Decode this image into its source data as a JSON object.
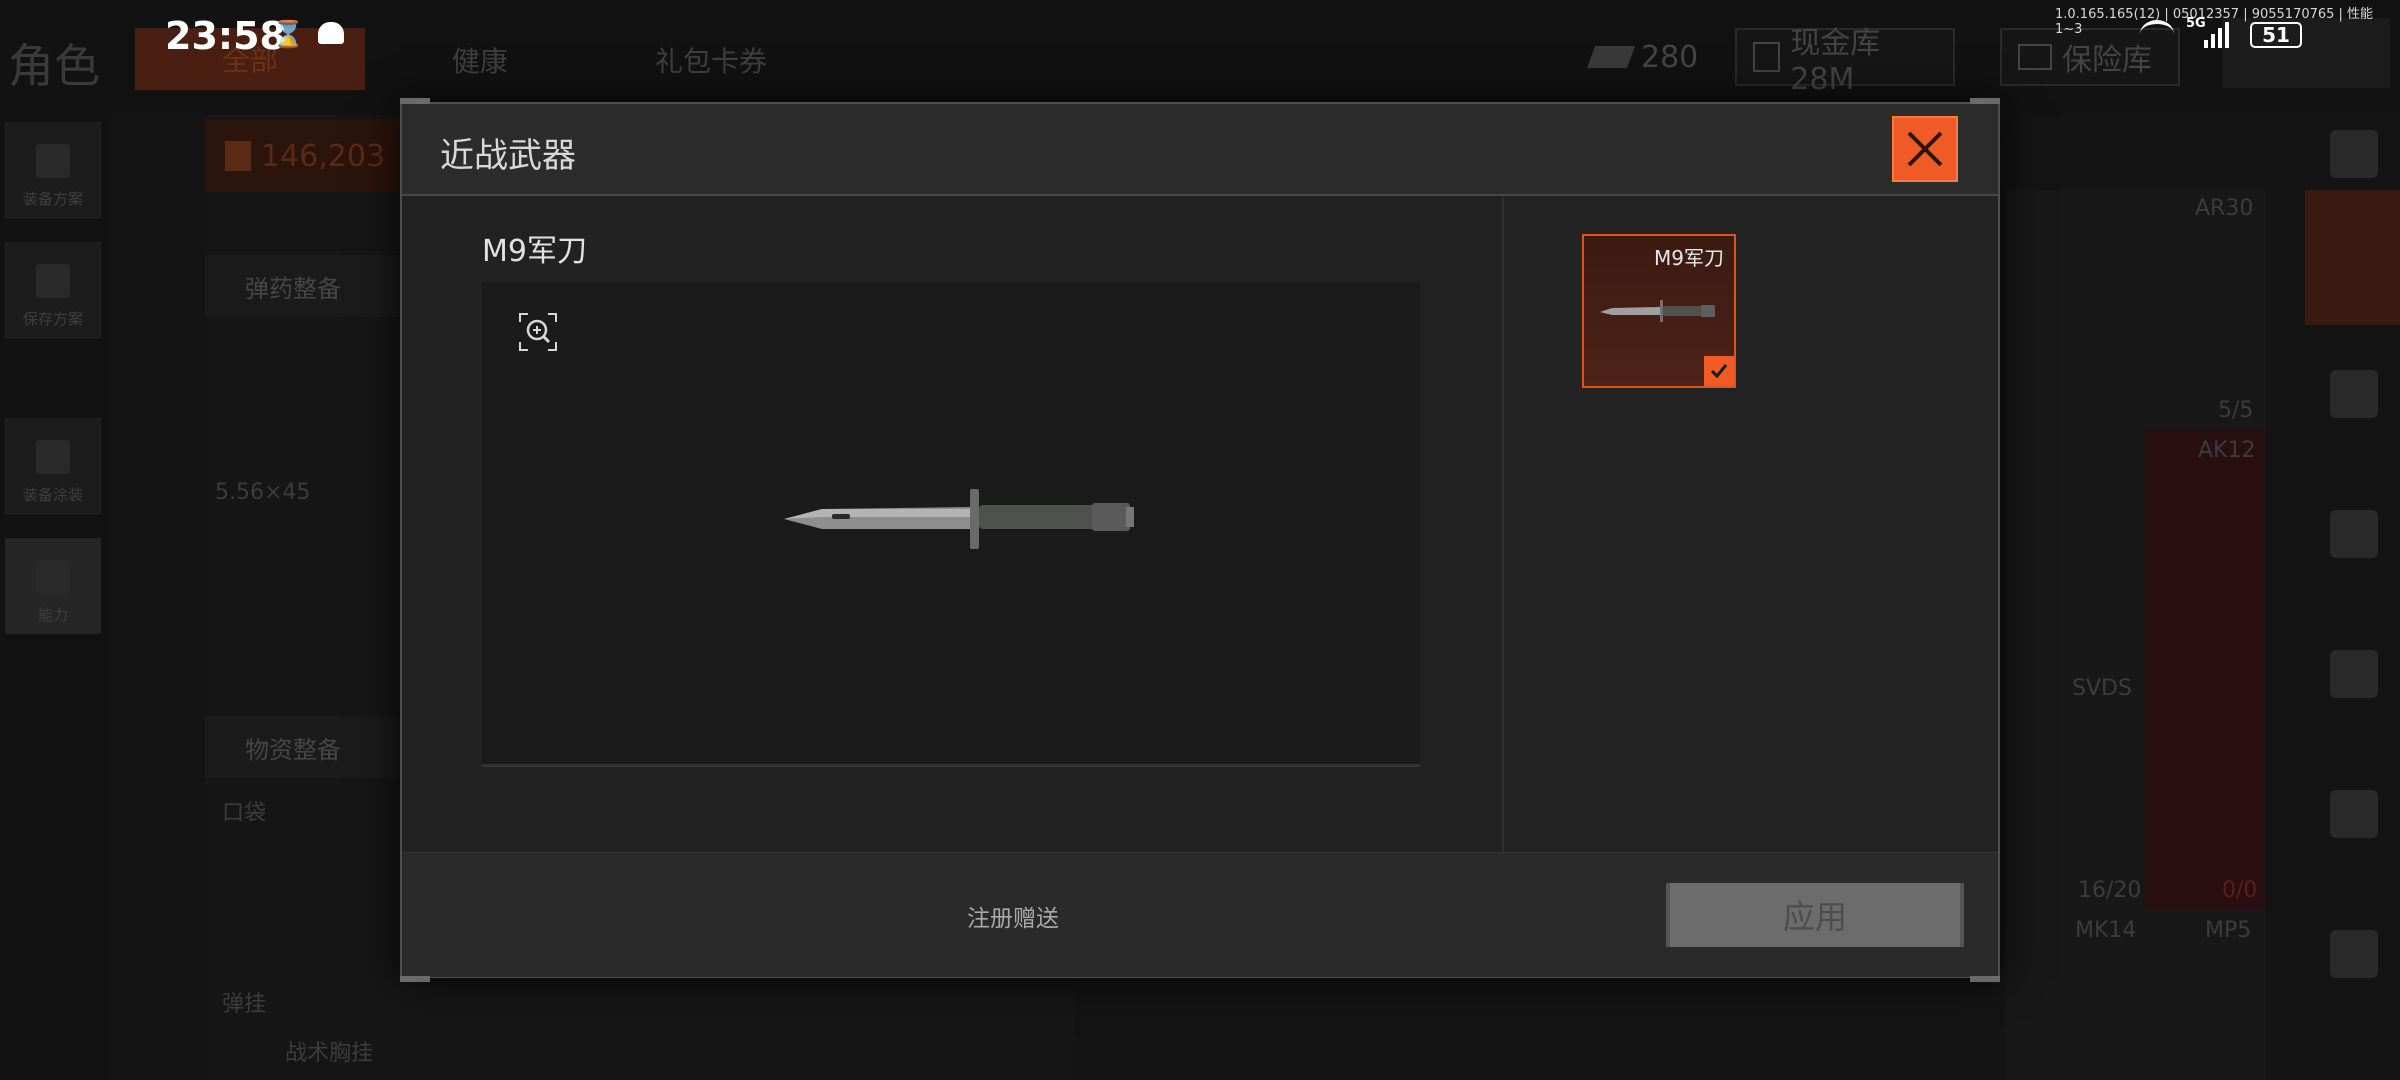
{
  "status_bar": {
    "time": "23:58",
    "build_info": "1.0.165.165(12) | 05012357 | 9055170765 | 性能1~3",
    "network": "5G",
    "battery": "51"
  },
  "background": {
    "page_title": "角色",
    "tabs": [
      "全部",
      "健康",
      "礼包卡券"
    ],
    "currency_count": "280",
    "cash_label": "现金库 28M",
    "safe_label": "保险库",
    "loadout_value": "146,203",
    "rail": [
      "装备方案",
      "保存方案",
      "装备涂装",
      "能力"
    ],
    "ammo_section": "弹药整备",
    "caliber": "5.56×45",
    "supply_section": "物资整备",
    "pocket_label": "口袋",
    "rig_label": "弹挂",
    "rig_item": "战术胸挂",
    "weapons": [
      "AR30",
      "AK12",
      "SVDS",
      "MK14",
      "MP5"
    ],
    "ammo_counts": [
      "5/5",
      "16/20",
      "0/0"
    ]
  },
  "modal": {
    "title": "近战武器",
    "selected_item": "M9军刀",
    "options": [
      {
        "name": "M9军刀",
        "selected": true
      }
    ],
    "source_note": "注册赠送",
    "apply_label": "应用"
  },
  "colors": {
    "accent": "#f05a24",
    "modal_bg": "#252525",
    "apply_disabled": "#6c6c6c"
  },
  "icons": {
    "zoom": "zoom-in-icon",
    "close": "close-icon",
    "check": "check-icon"
  }
}
